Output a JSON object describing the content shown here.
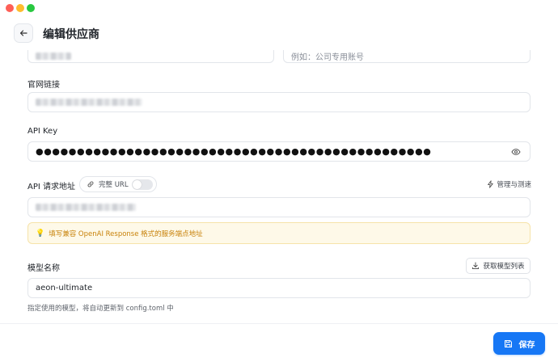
{
  "window": {
    "controls": [
      "close",
      "minimize",
      "maximize"
    ]
  },
  "header": {
    "title": "编辑供应商"
  },
  "form": {
    "name_placeholder_right": "例如：公司专用账号",
    "website_label": "官网链接",
    "api_key_label": "API Key",
    "api_key_value": "●●●●●●●●●●●●●●●●●●●●●●●●●●●●●●●●●●●●●●●●●●●●●●●●",
    "api_url_label": "API 请求地址",
    "full_url_toggle_label": "完整 URL",
    "full_url_enabled": false,
    "manage_label": "管理与测速",
    "hint_text": "填写兼容 OpenAI Response 格式的服务端点地址",
    "model_label": "模型名称",
    "fetch_models_label": "获取模型列表",
    "model_value": "aeon-ultimate",
    "model_helper": "指定使用的模型，将自动更新到 config.toml 中"
  },
  "footer": {
    "save_label": "保存"
  },
  "colors": {
    "primary": "#1677f5",
    "hint_bg": "#fef9e8",
    "hint_text": "#c8820a"
  },
  "icons": {
    "back": "arrow-left-icon",
    "eye": "eye-icon",
    "link": "link-icon",
    "manage": "lightning-icon",
    "bulb": "lightbulb-icon",
    "download": "download-icon",
    "save": "floppy-icon"
  }
}
